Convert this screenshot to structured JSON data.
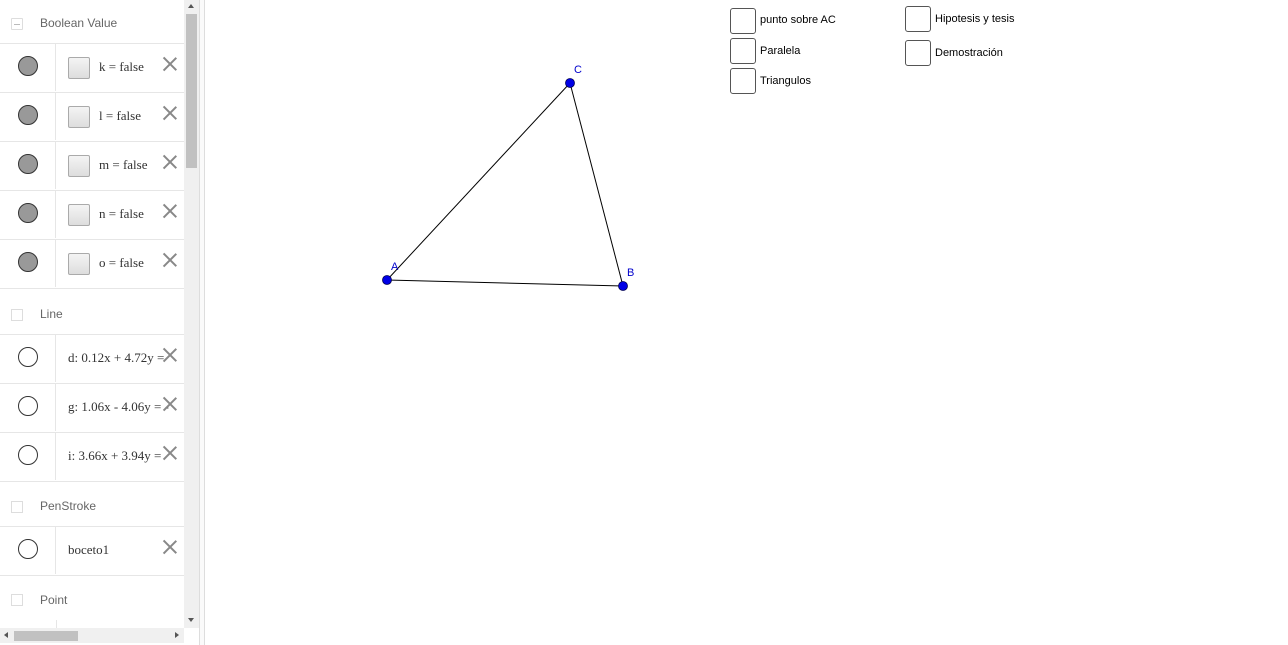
{
  "algebra": {
    "groups": [
      {
        "name": "Boolean Value"
      },
      {
        "name": "Line"
      },
      {
        "name": "PenStroke"
      },
      {
        "name": "Point"
      }
    ],
    "booleans": [
      {
        "def": "k = false"
      },
      {
        "def": "l = false"
      },
      {
        "def": "m = false"
      },
      {
        "def": "n = false"
      },
      {
        "def": "o = false"
      }
    ],
    "lines": [
      {
        "def": "d: 0.12x + 4.72y = "
      },
      {
        "def": "g: 1.06x - 4.06y = -"
      },
      {
        "def": "i: 3.66x + 3.94y = "
      }
    ],
    "penstrokes": [
      {
        "def": "boceto1"
      }
    ]
  },
  "graphics": {
    "checkboxes": [
      {
        "label": "punto sobre AC"
      },
      {
        "label": "Paralela"
      },
      {
        "label": "Triangulos"
      },
      {
        "label": "Hipotesis y tesis"
      },
      {
        "label": "Demostración"
      }
    ],
    "points": [
      {
        "label": "A"
      },
      {
        "label": "B"
      },
      {
        "label": "C"
      }
    ]
  },
  "colors": {
    "point": "#0000e6",
    "point_label": "#0000cc",
    "segment": "#000000"
  }
}
